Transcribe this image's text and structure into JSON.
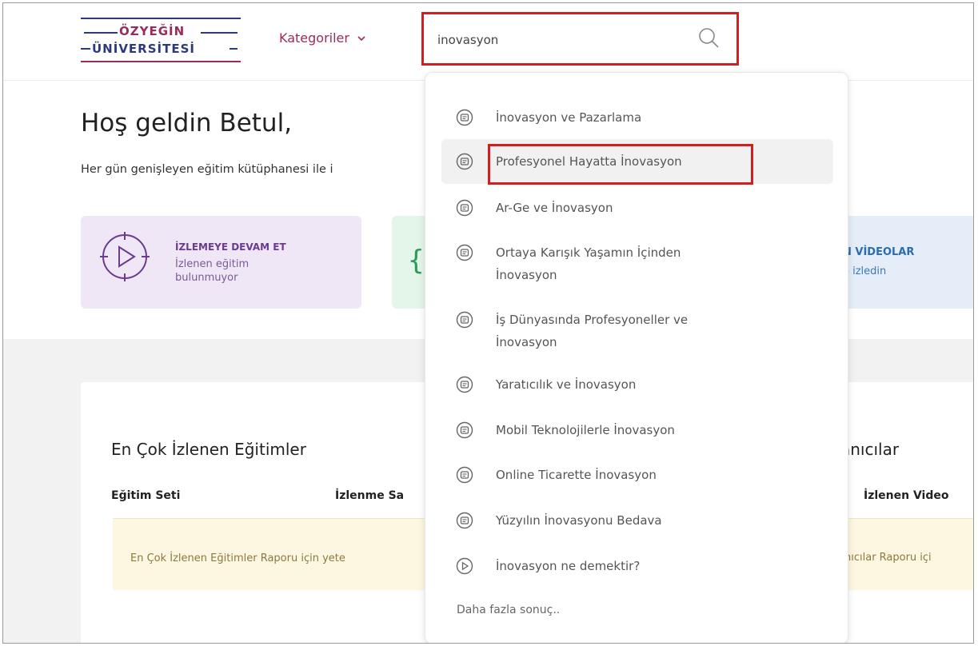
{
  "header": {
    "logo_line1": "ÖZYEĞİN",
    "logo_line2": "ÜNİVERSİTESİ",
    "categories_label": "Kategoriler",
    "search": {
      "value": "inovasyon"
    }
  },
  "main": {
    "greeting": "Hoş geldin Betul,",
    "subtext": "Her gün genişleyen eğitim kütüphanesi ile i",
    "cards": {
      "continue_title": "İZLEMEYE DEVAM ET",
      "continue_sub": "İzlenen eğitim bulunmuyor",
      "blue_title": "N VİDEOLAR",
      "blue_sub": "o izledin"
    },
    "panel": {
      "title": "En Çok İzlenen Eğitimler",
      "col_1": "Eğitim Seti",
      "col_2": "İzlenme Sa",
      "notice": "En Çok İzlenen Eğitimler Raporu için yete",
      "right_title": "anıcılar",
      "right_col": "İzlenen Video",
      "right_notice": "nıcılar Raporu içi"
    }
  },
  "dropdown": {
    "items": [
      {
        "label": "İnovasyon ve Pazarlama",
        "icon": "video-list-icon"
      },
      {
        "label": "Profesyonel Hayatta İnovasyon",
        "icon": "video-list-icon"
      },
      {
        "label": "Ar-Ge ve İnovasyon",
        "icon": "video-list-icon"
      },
      {
        "label": "Ortaya Karışık Yaşamın İçinden",
        "label2": "İnovasyon",
        "icon": "video-list-icon"
      },
      {
        "label": "İş Dünyasında Profesyoneller ve",
        "label2": "İnovasyon",
        "icon": "video-list-icon"
      },
      {
        "label": "Yaratıcılık ve İnovasyon",
        "icon": "video-list-icon"
      },
      {
        "label": "Mobil Teknolojilerle İnovasyon",
        "icon": "video-list-icon"
      },
      {
        "label": "Online Ticarette İnovasyon",
        "icon": "video-list-icon"
      },
      {
        "label": "Yüzyılın İnovasyonu Bedava",
        "icon": "video-list-icon"
      },
      {
        "label": "İnovasyon ne demektir?",
        "icon": "play-circle-icon"
      }
    ],
    "more_label": "Daha fazla sonuç.."
  },
  "colors": {
    "brand_maroon": "#9b2b5a",
    "brand_navy": "#2a3a7a",
    "highlight_red": "#d11f1f"
  }
}
